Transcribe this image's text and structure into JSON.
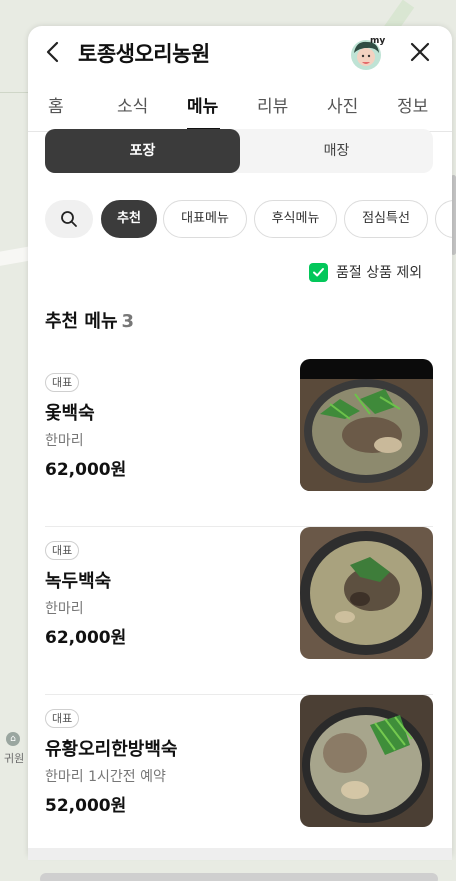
{
  "header": {
    "title": "토종생오리농원"
  },
  "tabs": [
    {
      "label": "홈",
      "active": false
    },
    {
      "label": "소식",
      "active": false
    },
    {
      "label": "메뉴",
      "active": true
    },
    {
      "label": "리뷰",
      "active": false
    },
    {
      "label": "사진",
      "active": false
    },
    {
      "label": "정보",
      "active": false
    }
  ],
  "order_type": {
    "options": [
      "포장",
      "매장"
    ],
    "selected": "포장"
  },
  "categories": {
    "search_icon": "search-icon",
    "chips": [
      "추천",
      "대표메뉴",
      "후식메뉴",
      "점심특선"
    ],
    "selected": "추천"
  },
  "filter": {
    "exclude_soldout_label": "품절 상품 제외",
    "checked": true
  },
  "section": {
    "title": "추천 메뉴",
    "count": "3"
  },
  "menu_items": [
    {
      "badge": "대표",
      "name": "옻백숙",
      "desc": "한마리",
      "price": "62,000원"
    },
    {
      "badge": "대표",
      "name": "녹두백숙",
      "desc": "한마리",
      "price": "62,000원"
    },
    {
      "badge": "대표",
      "name": "유황오리한방백숙",
      "desc": "한마리 1시간전 예약",
      "price": "52,000원"
    }
  ],
  "map": {
    "poi_label": "귀원"
  },
  "colors": {
    "accent_green": "#03c75a",
    "dark_button": "#3b3b3b"
  }
}
